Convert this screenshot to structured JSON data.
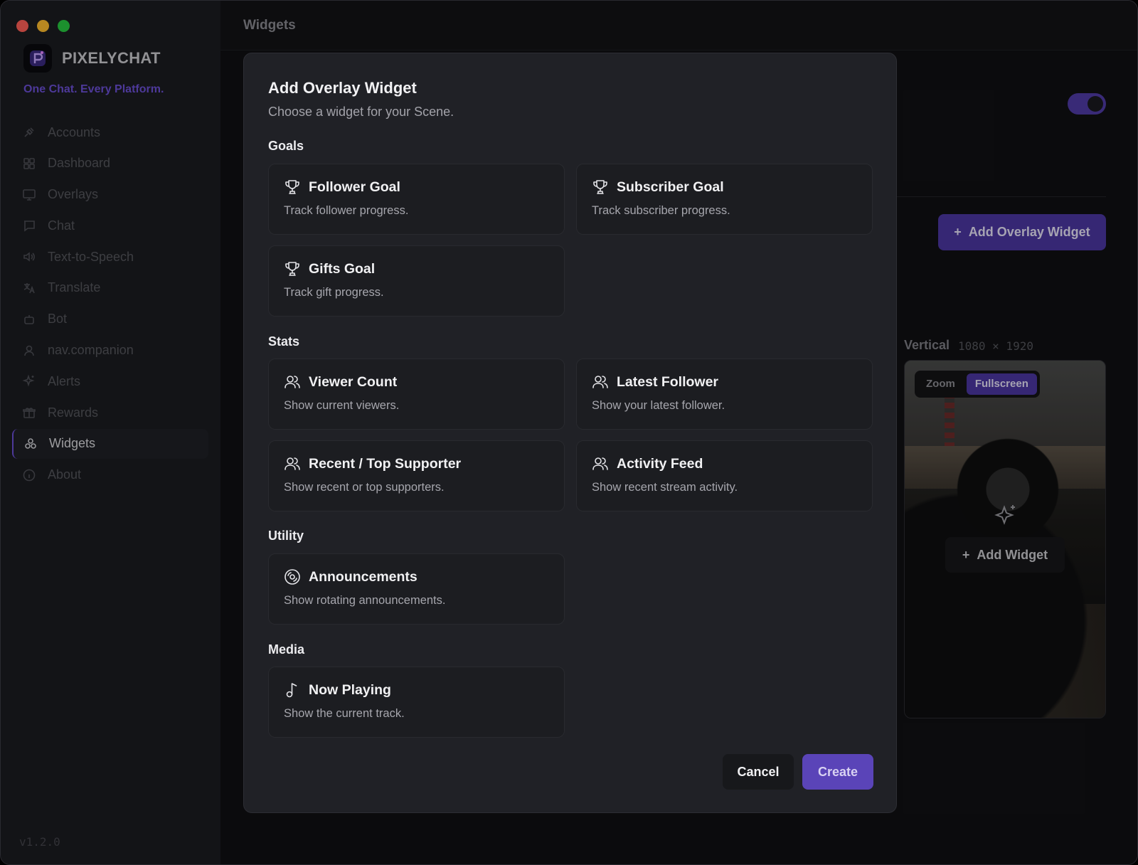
{
  "window": {
    "title": "Widgets"
  },
  "sidebar": {
    "brand": "PIXELYCHAT",
    "tagline": "One Chat. Every Platform.",
    "version": "v1.2.0",
    "items": [
      {
        "label": "Accounts",
        "icon": "plug-icon"
      },
      {
        "label": "Dashboard",
        "icon": "grid-icon"
      },
      {
        "label": "Overlays",
        "icon": "monitor-icon"
      },
      {
        "label": "Chat",
        "icon": "message-icon"
      },
      {
        "label": "Text-to-Speech",
        "icon": "speaker-icon"
      },
      {
        "label": "Translate",
        "icon": "translate-icon"
      },
      {
        "label": "Bot",
        "icon": "bot-icon"
      },
      {
        "label": "nav.companion",
        "icon": "user-icon"
      },
      {
        "label": "Alerts",
        "icon": "sparkle-icon"
      },
      {
        "label": "Rewards",
        "icon": "gift-icon"
      },
      {
        "label": "Widgets",
        "icon": "widgets-icon",
        "active": true
      },
      {
        "label": "About",
        "icon": "info-icon"
      }
    ]
  },
  "background": {
    "add_overlay_widget": "Add Overlay Widget",
    "vertical_label": "Vertical",
    "vertical_dims": "1080 × 1920",
    "preview_tabs": [
      "Zoom",
      "Fullscreen"
    ],
    "preview_selected": "Fullscreen",
    "add_widget": "Add Widget",
    "toggle_on": true
  },
  "modal": {
    "title": "Add Overlay Widget",
    "subtitle": "Choose a widget for your Scene.",
    "sections": [
      {
        "label": "Goals",
        "cards": [
          {
            "title": "Follower Goal",
            "desc": "Track follower progress.",
            "icon": "trophy-icon"
          },
          {
            "title": "Subscriber Goal",
            "desc": "Track subscriber progress.",
            "icon": "trophy-icon"
          },
          {
            "title": "Gifts Goal",
            "desc": "Track gift progress.",
            "icon": "trophy-icon"
          }
        ]
      },
      {
        "label": "Stats",
        "cards": [
          {
            "title": "Viewer Count",
            "desc": "Show current viewers.",
            "icon": "users-icon"
          },
          {
            "title": "Latest Follower",
            "desc": "Show your latest follower.",
            "icon": "users-icon"
          },
          {
            "title": "Recent / Top Supporter",
            "desc": "Show recent or top supporters.",
            "icon": "users-icon"
          },
          {
            "title": "Activity Feed",
            "desc": "Show recent stream activity.",
            "icon": "users-icon"
          }
        ]
      },
      {
        "label": "Utility",
        "cards": [
          {
            "title": "Announcements",
            "desc": "Show rotating announcements.",
            "icon": "disc-icon"
          }
        ]
      },
      {
        "label": "Media",
        "cards": [
          {
            "title": "Now Playing",
            "desc": "Show the current track.",
            "icon": "music-note-icon"
          }
        ]
      }
    ],
    "cancel": "Cancel",
    "create": "Create"
  }
}
